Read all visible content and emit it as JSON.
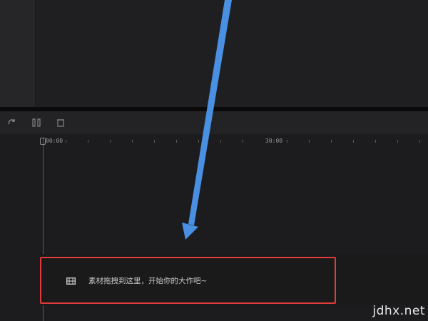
{
  "ruler": {
    "start_label": "00:00",
    "mid_label": "30:00"
  },
  "drop_zone": {
    "hint_text": "素材拖拽到这里，开始你的大作吧~",
    "icon": "film-icon"
  },
  "toolbar": {
    "icons": [
      "redo-icon",
      "split-icon",
      "delete-icon"
    ]
  },
  "watermark": "jdhx.net",
  "colors": {
    "highlight_border": "#e03a3a",
    "annotation_arrow": "#4a90e2",
    "background": "#1d1d1f"
  }
}
